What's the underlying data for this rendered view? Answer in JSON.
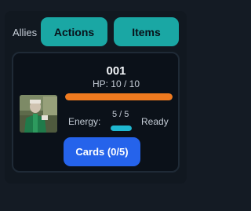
{
  "tabs": {
    "allies_label": "Allies",
    "actions_label": "Actions",
    "items_label": "Items"
  },
  "unit": {
    "name": "001",
    "hp_text": "HP: 10 / 10",
    "hp_current": 10,
    "hp_max": 10,
    "energy_label": "Energy:",
    "energy_text": "5 / 5",
    "energy_current": 5,
    "energy_max": 5,
    "status": "Ready",
    "cards_button_label": "Cards (0/5)"
  },
  "colors": {
    "tab_accent": "#1aa7a4",
    "hp_bar": "#ef7a1f",
    "energy_bar": "#1fb7d0",
    "cards_button": "#2563eb",
    "background": "#141b24"
  },
  "icons": {
    "avatar": "character-portrait"
  }
}
